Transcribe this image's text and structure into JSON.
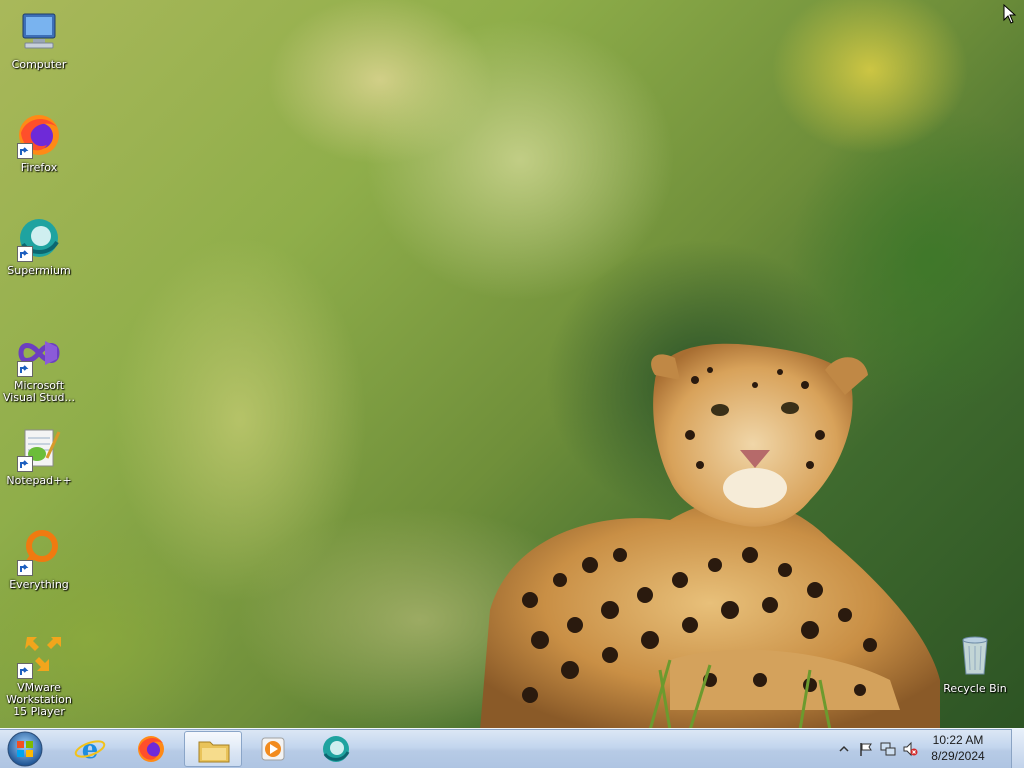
{
  "desktop": {
    "icons": [
      {
        "label": "Computer",
        "icon": "computer-icon"
      },
      {
        "label": "Firefox",
        "icon": "firefox-icon"
      },
      {
        "label": "Supermium",
        "icon": "supermium-icon"
      },
      {
        "label": "Microsoft Visual Stud...",
        "icon": "visual-studio-icon"
      },
      {
        "label": "Notepad++",
        "icon": "notepadpp-icon"
      },
      {
        "label": "Everything",
        "icon": "everything-icon"
      },
      {
        "label": "VMware Workstation 15 Player",
        "icon": "vmware-icon"
      },
      {
        "label": "Recycle Bin",
        "icon": "recycle-bin-icon"
      }
    ]
  },
  "taskbar": {
    "pinned": [
      {
        "name": "Internet Explorer",
        "icon": "internet-explorer-icon"
      },
      {
        "name": "Firefox",
        "icon": "firefox-icon"
      },
      {
        "name": "Windows Explorer",
        "icon": "folder-icon"
      },
      {
        "name": "Windows Media Player",
        "icon": "media-player-icon"
      },
      {
        "name": "Supermium",
        "icon": "supermium-icon"
      }
    ],
    "tray": {
      "icons": [
        "show-hidden-icons",
        "action-center-flag-icon",
        "network-icon",
        "volume-muted-icon"
      ],
      "time": "10:22 AM",
      "date": "8/29/2024"
    }
  },
  "colors": {
    "taskbar_top": "#dde8f5",
    "taskbar_bottom": "#aec4e2",
    "label_text": "#ffffff"
  }
}
